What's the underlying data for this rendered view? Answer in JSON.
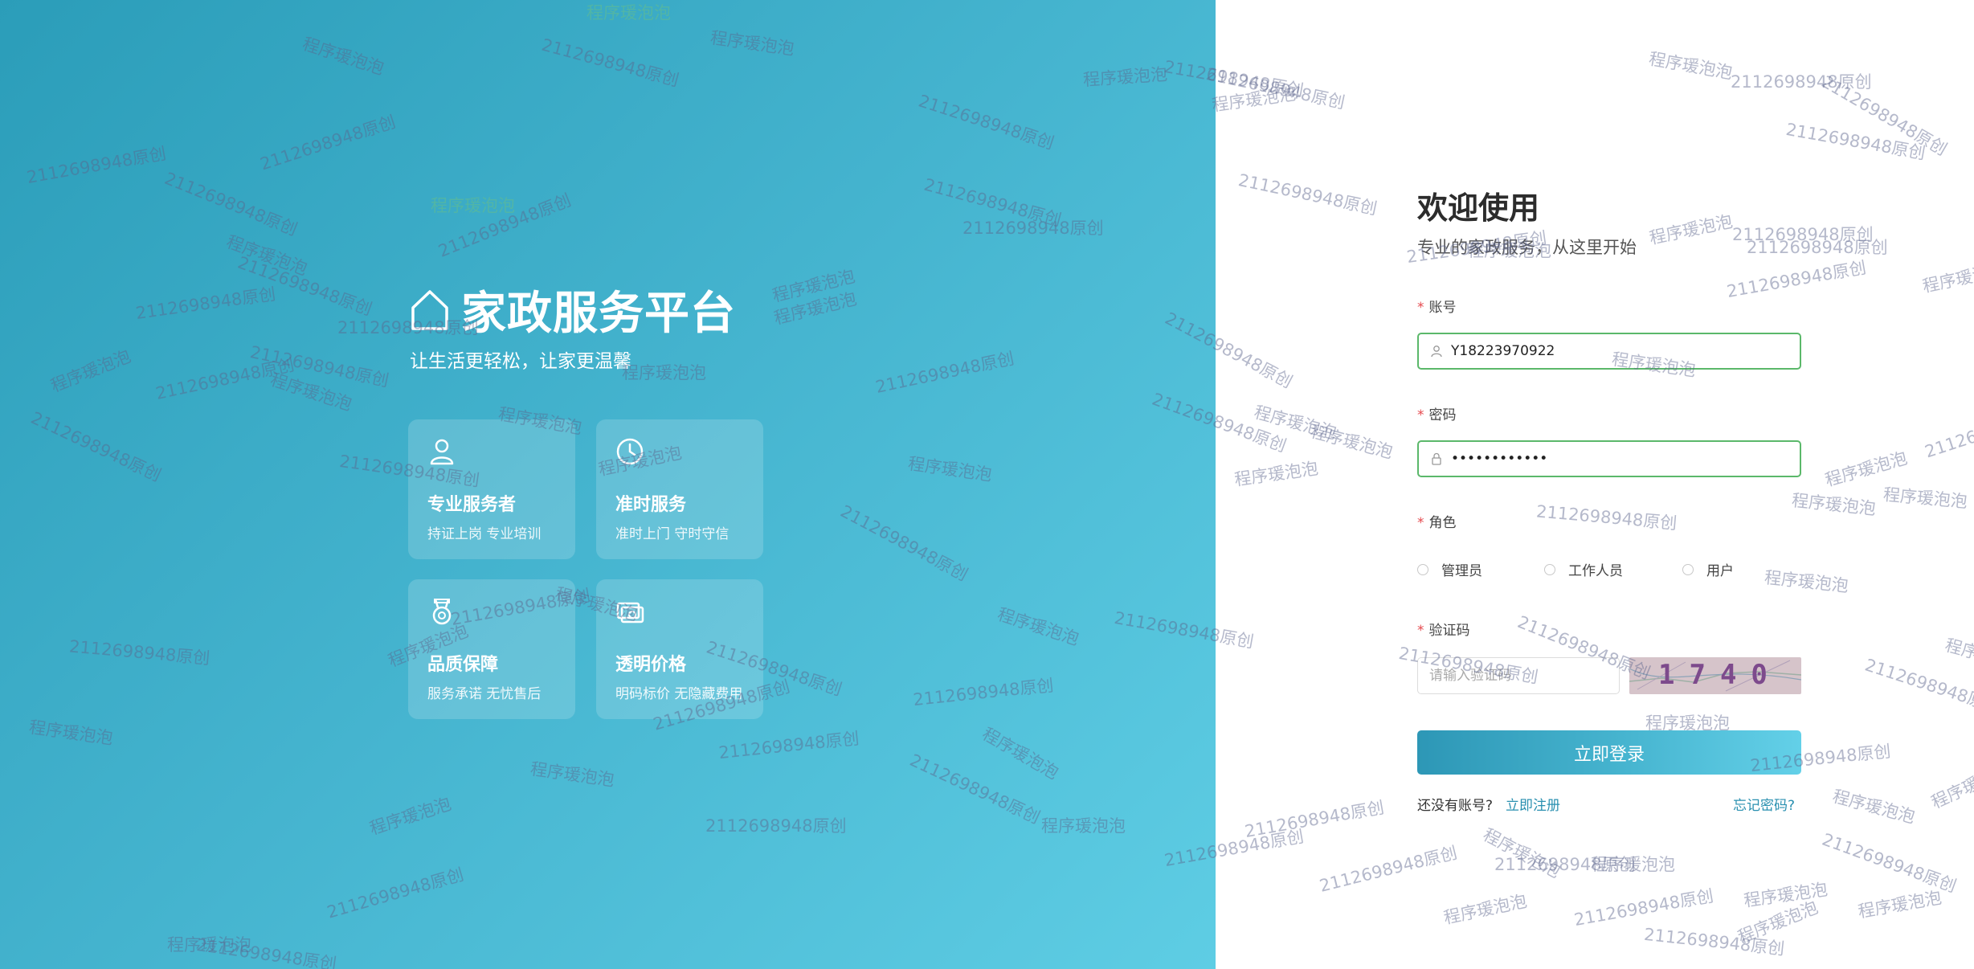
{
  "hero": {
    "title": "家政服务平台",
    "subtitle": "让生活更轻松，让家更温馨",
    "features": [
      {
        "icon": "person-icon",
        "title": "专业服务者",
        "desc": "持证上岗 专业培训"
      },
      {
        "icon": "clock-icon",
        "title": "准时服务",
        "desc": "准时上门 守时守信"
      },
      {
        "icon": "medal-icon",
        "title": "品质保障",
        "desc": "服务承诺 无忧售后"
      },
      {
        "icon": "money-icon",
        "title": "透明价格",
        "desc": "明码标价 无隐藏费用"
      }
    ]
  },
  "login": {
    "welcome": "欢迎使用",
    "subtitle": "专业的家政服务，从这里开始",
    "account": {
      "label": "账号",
      "value": "Y18223970922"
    },
    "password": {
      "label": "密码",
      "value": "••••••••••••"
    },
    "role": {
      "label": "角色",
      "options": [
        "管理员",
        "工作人员",
        "用户"
      ]
    },
    "captcha": {
      "label": "验证码",
      "placeholder": "请输入验证码",
      "code": "1740"
    },
    "submit_label": "立即登录",
    "no_account": "还没有账号?",
    "register": "立即注册",
    "forgot": "忘记密码?"
  },
  "watermark": {
    "author": "程序瑗泡泡",
    "id": "2112698948原创"
  },
  "colors": {
    "accent": "#2a90b0",
    "input_border": "#5bb86a",
    "required": "#e5484d"
  }
}
